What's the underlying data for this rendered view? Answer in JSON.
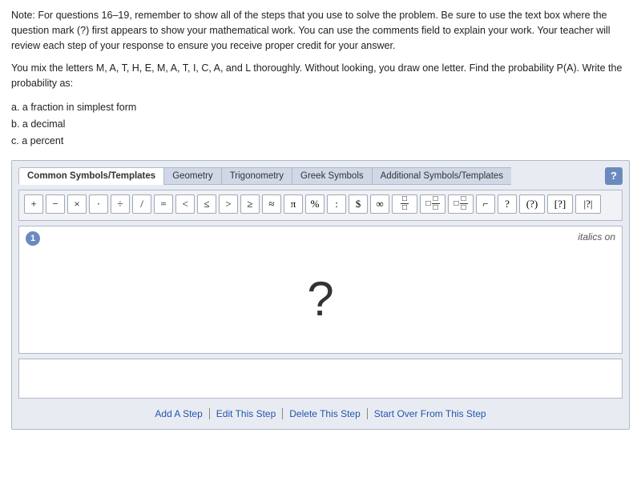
{
  "note": {
    "text": "Note: For questions 16–19, remember to show all of the steps that you use to solve the problem. Be sure to use the text box where the question mark (?) first appears to show your mathematical work. You can use the comments field to explain your work. Your teacher will review each step of your response to ensure you receive proper credit for your answer."
  },
  "question": {
    "text": "You mix the letters M, A, T, H, E, M, A, T, I, C, A, and L thoroughly. Without looking, you draw one letter. Find the probability P(A). Write the probability as:"
  },
  "subquestions": {
    "a": "a. a fraction in simplest form",
    "b": "b. a decimal",
    "c": "c. a percent"
  },
  "tabs": [
    {
      "label": "Common Symbols/Templates",
      "active": true
    },
    {
      "label": "Geometry",
      "active": false
    },
    {
      "label": "Trigonometry",
      "active": false
    },
    {
      "label": "Greek Symbols",
      "active": false
    },
    {
      "label": "Additional Symbols/Templates",
      "active": false
    }
  ],
  "help_btn": "?",
  "symbols_row1": [
    "+",
    "−",
    "×",
    "·",
    "÷",
    "/",
    "=",
    "<",
    "≤",
    ">",
    "≥",
    "≈",
    "π",
    "%",
    ":",
    "$",
    "∞"
  ],
  "symbols_row2": [
    "⊟",
    "⊡",
    "⊡",
    "⌐",
    "?",
    "(?)",
    "[?]",
    "|?|"
  ],
  "step": {
    "number": "1",
    "italics_label": "italics on",
    "content": "?"
  },
  "actions": {
    "add": "Add A Step",
    "edit": "Edit This Step",
    "delete": "Delete This Step",
    "start_over": "Start Over From This Step"
  }
}
